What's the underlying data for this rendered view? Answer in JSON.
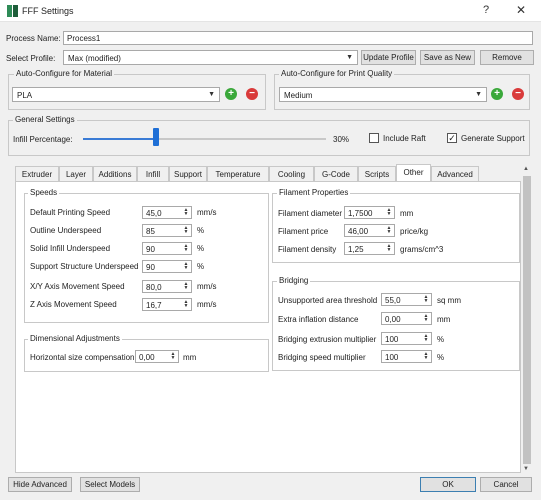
{
  "window": {
    "title": "FFF Settings",
    "help_label": "?",
    "close_label": "✕"
  },
  "process_name": {
    "label": "Process Name:",
    "value": "Process1"
  },
  "select_profile": {
    "label": "Select Profile:",
    "value": "Max (modified)",
    "update_label": "Update Profile",
    "save_as_label": "Save as New",
    "remove_label": "Remove"
  },
  "auto_material": {
    "title": "Auto-Configure for Material",
    "value": "PLA"
  },
  "auto_quality": {
    "title": "Auto-Configure for Print Quality",
    "value": "Medium"
  },
  "general": {
    "title": "General Settings",
    "infill_label": "Infill Percentage:",
    "infill_value": "30%",
    "infill_fraction": 0.3,
    "include_raft_label": "Include Raft",
    "include_raft_checked": false,
    "generate_support_label": "Generate Support",
    "generate_support_checked": true
  },
  "tabs": [
    {
      "label": "Extruder"
    },
    {
      "label": "Layer"
    },
    {
      "label": "Additions"
    },
    {
      "label": "Infill"
    },
    {
      "label": "Support"
    },
    {
      "label": "Temperature"
    },
    {
      "label": "Cooling"
    },
    {
      "label": "G-Code"
    },
    {
      "label": "Scripts"
    },
    {
      "label": "Other"
    },
    {
      "label": "Advanced"
    }
  ],
  "active_tab": "Other",
  "speeds": {
    "title": "Speeds",
    "rows": [
      {
        "label": "Default Printing Speed",
        "value": "45,0",
        "unit": "mm/s"
      },
      {
        "label": "Outline Underspeed",
        "value": "85",
        "unit": "%"
      },
      {
        "label": "Solid Infill Underspeed",
        "value": "90",
        "unit": "%"
      },
      {
        "label": "Support Structure Underspeed",
        "value": "90",
        "unit": "%"
      },
      {
        "label": "X/Y Axis Movement Speed",
        "value": "80,0",
        "unit": "mm/s"
      },
      {
        "label": "Z Axis Movement Speed",
        "value": "16,7",
        "unit": "mm/s"
      }
    ]
  },
  "dimensional": {
    "title": "Dimensional Adjustments",
    "label": "Horizontal size compensation",
    "value": "0,00",
    "unit": "mm"
  },
  "filament": {
    "title": "Filament Properties",
    "rows": [
      {
        "label": "Filament diameter",
        "value": "1,7500",
        "unit": "mm"
      },
      {
        "label": "Filament price",
        "value": "46,00",
        "unit": "price/kg"
      },
      {
        "label": "Filament density",
        "value": "1,25",
        "unit": "grams/cm^3"
      }
    ]
  },
  "bridging": {
    "title": "Bridging",
    "rows": [
      {
        "label": "Unsupported area threshold",
        "value": "55,0",
        "unit": "sq mm"
      },
      {
        "label": "Extra inflation distance",
        "value": "0,00",
        "unit": "mm"
      },
      {
        "label": "Bridging extrusion multiplier",
        "value": "100",
        "unit": "%"
      },
      {
        "label": "Bridging speed multiplier",
        "value": "100",
        "unit": "%"
      }
    ]
  },
  "footer": {
    "hide_advanced_label": "Hide Advanced",
    "select_models_label": "Select Models",
    "ok_label": "OK",
    "cancel_label": "Cancel"
  }
}
